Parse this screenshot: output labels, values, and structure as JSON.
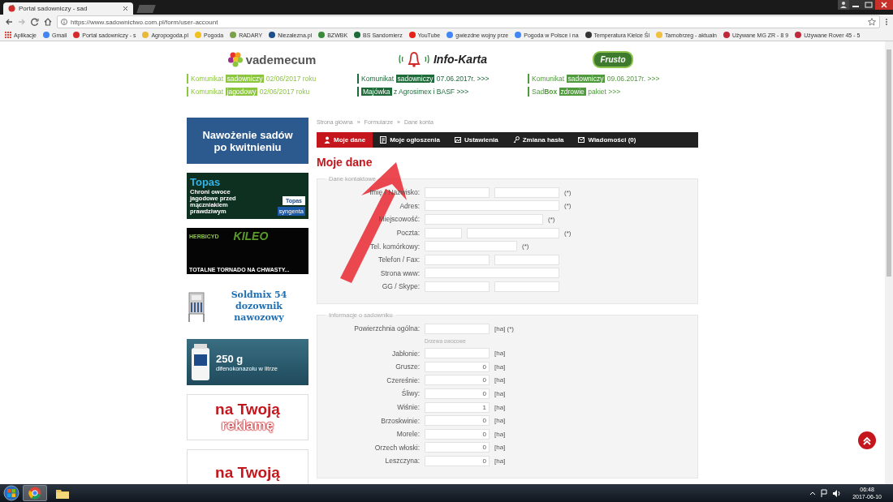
{
  "browser": {
    "tabs": [
      {
        "title": "Portal sadowniczy - sad",
        "selected": true
      }
    ],
    "url": "https://www.sadownictwo.com.pl/form/user-account",
    "bookmarks": [
      {
        "kind": "apps",
        "label": "Aplikacje"
      },
      {
        "kind": "site",
        "label": "Gmail",
        "color": "#4285f4"
      },
      {
        "kind": "site",
        "label": "Portal sadowniczy - s",
        "color": "#d42a2a"
      },
      {
        "kind": "site",
        "label": "Agropogoda.pl",
        "color": "#e8b83a"
      },
      {
        "kind": "site",
        "label": "Pogoda",
        "color": "#f0c020"
      },
      {
        "kind": "site",
        "label": "RADARY",
        "color": "#7aa04a"
      },
      {
        "kind": "site",
        "label": "Niezalezna.pl",
        "color": "#1c4f8a"
      },
      {
        "kind": "site",
        "label": "BZWBK",
        "color": "#3a8a3a"
      },
      {
        "kind": "site",
        "label": "BS Sandomierz",
        "color": "#1b6b3a"
      },
      {
        "kind": "site",
        "label": "YouTube",
        "color": "#e62117"
      },
      {
        "kind": "site",
        "label": "gwiezdne wojny prze",
        "color": "#4285f5"
      },
      {
        "kind": "site",
        "label": "Pogoda w Polsce i na",
        "color": "#4286f4"
      },
      {
        "kind": "site",
        "label": "Temperatura Kielce Śl",
        "color": "#333333"
      },
      {
        "kind": "site",
        "label": "Tarnobrzeg - aktualn",
        "color": "#f0c040"
      },
      {
        "kind": "site",
        "label": "Używane MG ZR - 8 9",
        "color": "#c0283a"
      },
      {
        "kind": "site",
        "label": "Używane Rover 45 - 5",
        "color": "#c0283b"
      }
    ]
  },
  "header": {
    "columns": [
      {
        "kind": "vademecum",
        "logo": "vademecum",
        "color": "#8cc63f",
        "news": [
          [
            {
              "text": "Komunikat ",
              "tag": false
            },
            {
              "text": "sadowniczy",
              "tag": true
            },
            {
              "text": " 02/06/2017 roku",
              "tag": false
            }
          ],
          [
            {
              "text": "Komunikat ",
              "tag": false
            },
            {
              "text": "jagodowy",
              "tag": true
            },
            {
              "text": " 02/06/2017 roku",
              "tag": false
            }
          ]
        ]
      },
      {
        "kind": "infokarta",
        "logo": "Info-Karta",
        "color": "#1e6b3a",
        "news": [
          [
            {
              "text": "Komunikat ",
              "tag": false
            },
            {
              "text": "sadowniczy",
              "tag": true
            },
            {
              "text": " 07.06.2017r. >>>",
              "tag": false
            }
          ],
          [
            {
              "text": "Majówka",
              "tag": true
            },
            {
              "text": " z Agrosimex i BASF >>>",
              "tag": false
            }
          ]
        ]
      },
      {
        "kind": "frusto",
        "logo": "Frusto",
        "color": "#4f9a3b",
        "news": [
          [
            {
              "text": "Komunikat ",
              "tag": false
            },
            {
              "text": "sadowniczy",
              "tag": true
            },
            {
              "text": " 09.06.2017r. >>>",
              "tag": false
            }
          ],
          [
            {
              "text": "Sad**Box** ",
              "tag": false
            },
            {
              "text": "zdrowie",
              "tag": true
            },
            {
              "text": " pakiet >>>",
              "tag": false
            }
          ]
        ]
      }
    ]
  },
  "sidebar": {
    "ads": [
      {
        "kind": "text",
        "text": "Nawożenie sadów po kwitnieniu"
      },
      {
        "kind": "topas",
        "title": "Topas",
        "text": "Chroni owoce jagodowe przed mączniakiem prawdziwym",
        "brand": "Topas",
        "maker": "syngenta"
      },
      {
        "kind": "kileo",
        "label": "HERBICYD",
        "brand": "KILEO",
        "slogan": "TOTALNE TORNADO NA CHWASTY..."
      },
      {
        "kind": "soldmix",
        "text": "Soldmix 54 dozownik nawozowy"
      },
      {
        "kind": "product",
        "big": "250 g",
        "small": "difenokonazolu w litrze"
      },
      {
        "kind": "promo",
        "line1": "na Twoją",
        "line2": "reklamę"
      },
      {
        "kind": "promo",
        "line1": "na Twoją"
      }
    ]
  },
  "main": {
    "breadcrumb": {
      "separator": "»",
      "items": [
        "Strona główna",
        "Formularze",
        "Dane konta"
      ]
    },
    "tabs": [
      {
        "label": "Moje dane",
        "selected": true
      },
      {
        "label": "Moje ogłoszenia",
        "selected": false
      },
      {
        "label": "Ustawienia",
        "selected": false
      },
      {
        "label": "Zmiana hasła",
        "selected": false
      },
      {
        "label": "Wiadomości (0)",
        "selected": false
      }
    ],
    "heading": "Moje dane",
    "fieldsets": [
      {
        "legend": "Dane kontaktowe",
        "rows": [
          {
            "kind": "field",
            "label": "Imię / Nazwisko:",
            "inputs": [
              {
                "kind": "m"
              },
              {
                "kind": "m"
              }
            ],
            "note": "(*)"
          },
          {
            "kind": "field",
            "label": "Adres:",
            "inputs": [
              {
                "kind": "xxl"
              }
            ],
            "note": "(*)"
          },
          {
            "kind": "field",
            "label": "Miejscowość:",
            "inputs": [
              {
                "kind": "xl"
              }
            ],
            "note": "(*)"
          },
          {
            "kind": "field",
            "label": "Poczta:",
            "inputs": [
              {
                "kind": "s"
              },
              {
                "kind": "l"
              }
            ],
            "note": "(*)"
          },
          {
            "kind": "field",
            "label": "Tel. komórkowy:",
            "inputs": [
              {
                "kind": "l"
              }
            ],
            "note": "(*)"
          },
          {
            "kind": "field",
            "label": "Telefon / Fax:",
            "inputs": [
              {
                "kind": "m"
              },
              {
                "kind": "m"
              }
            ]
          },
          {
            "kind": "field",
            "label": "Strona www:",
            "inputs": [
              {
                "kind": "xxl"
              }
            ]
          },
          {
            "kind": "field",
            "label": "GG / Skype:",
            "inputs": [
              {
                "kind": "m"
              },
              {
                "kind": "m"
              }
            ]
          }
        ]
      },
      {
        "legend": "Informacje o sadowniku",
        "rows": [
          {
            "kind": "field",
            "label": "Powierzchnia ogólna:",
            "inputs": [
              {
                "kind": "m"
              }
            ],
            "note": "[ha] (*)"
          },
          {
            "kind": "subheading",
            "text": "Drzewa owocowe"
          },
          {
            "kind": "field",
            "label": "Jabłonie:",
            "inputs": [
              {
                "kind": "m"
              }
            ],
            "note": "[ha]"
          },
          {
            "kind": "field",
            "label": "Grusze:",
            "inputs": [
              {
                "kind": "m",
                "value": "0"
              }
            ],
            "note": "[ha]"
          },
          {
            "kind": "field",
            "label": "Czereśnie:",
            "inputs": [
              {
                "kind": "m",
                "value": "0"
              }
            ],
            "note": "[ha]"
          },
          {
            "kind": "field",
            "label": "Śliwy:",
            "inputs": [
              {
                "kind": "m",
                "value": "0"
              }
            ],
            "note": "[ha]"
          },
          {
            "kind": "field",
            "label": "Wiśnie:",
            "inputs": [
              {
                "kind": "m",
                "value": "1"
              }
            ],
            "note": "[ha]"
          },
          {
            "kind": "field",
            "label": "Brzoskwinie:",
            "inputs": [
              {
                "kind": "m",
                "value": "0"
              }
            ],
            "note": "[ha]"
          },
          {
            "kind": "field",
            "label": "Morele:",
            "inputs": [
              {
                "kind": "m",
                "value": "0"
              }
            ],
            "note": "[ha]"
          },
          {
            "kind": "field",
            "label": "Orzech włoski:",
            "inputs": [
              {
                "kind": "m",
                "value": "0"
              }
            ],
            "note": "[ha]"
          },
          {
            "kind": "field",
            "label": "Leszczyna:",
            "inputs": [
              {
                "kind": "m",
                "value": "0"
              }
            ],
            "note": "[ha]"
          }
        ]
      }
    ],
    "annotation": {
      "kind": "arrow"
    }
  },
  "back_to_top_button": true,
  "taskbar": {
    "apps": [
      {
        "kind": "browser",
        "active": true
      },
      {
        "kind": "folder",
        "active": false
      }
    ],
    "clock": {
      "time": "06:48",
      "date": "2017-06-10"
    }
  }
}
